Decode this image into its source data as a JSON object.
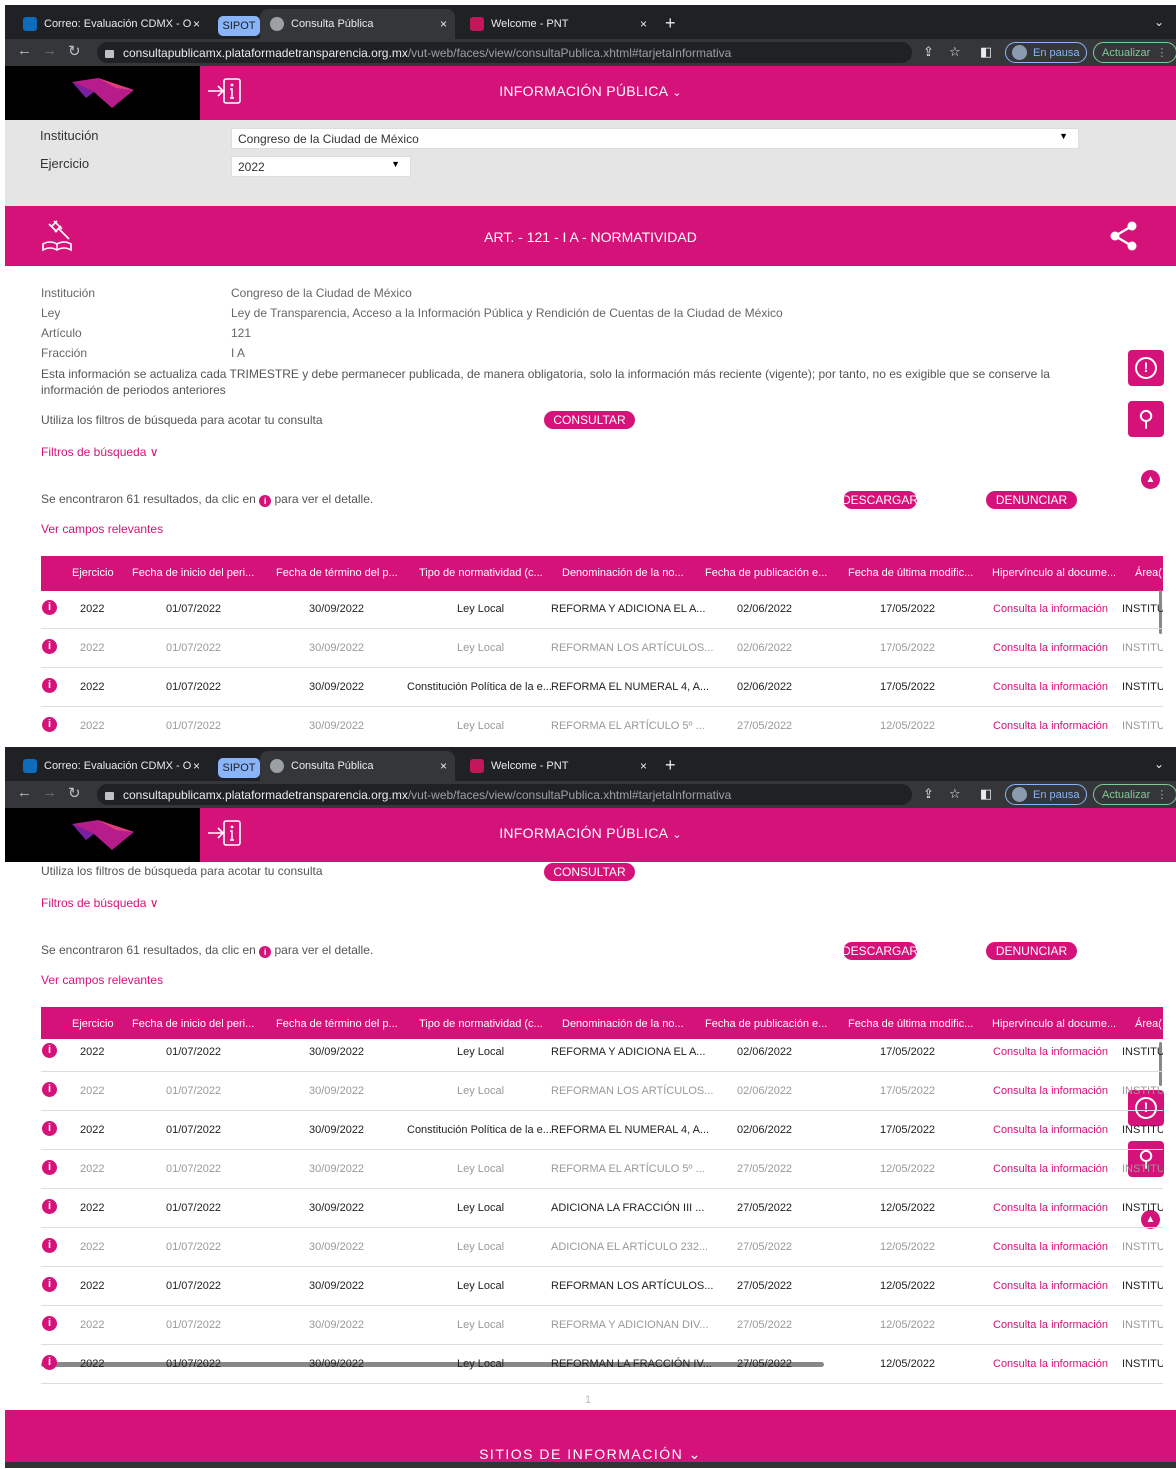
{
  "browser": {
    "tabs": [
      {
        "title": "Correo: Evaluación CDMX - O",
        "icon": "outlook-icon"
      },
      {
        "title": "Consulta Pública",
        "icon": "globe-icon"
      },
      {
        "title": "Welcome - PNT",
        "icon": "pnt-icon"
      }
    ],
    "tab_group_label": "SIPOT",
    "new_tab": "+",
    "close": "×",
    "url_host": "consultapublicamx.plataformadetransparencia.org.mx",
    "url_path": "/vut-web/faces/view/consultaPublica.xhtml#tarjetaInformativa",
    "paused_label": "En pausa",
    "update_label": "Actualizar"
  },
  "header": {
    "title": "INFORMACIÓN PÚBLICA",
    "chevron": "⌄",
    "exit_icon": "→ⅰ"
  },
  "filters": {
    "institution_label": "Institución",
    "institution_value": "Congreso de la Ciudad de México",
    "year_label": "Ejercicio",
    "year_value": "2022"
  },
  "article": {
    "title": "ART. - 121 - I A - NORMATIVIDAD"
  },
  "info": {
    "rows": [
      {
        "label": "Institución",
        "value": "Congreso de la Ciudad de México"
      },
      {
        "label": "Ley",
        "value": "Ley de Transparencia, Acceso a la Información Pública y Rendición de Cuentas de la Ciudad de México"
      },
      {
        "label": "Artículo",
        "value": "121"
      },
      {
        "label": "Fracción",
        "value": "I A"
      }
    ],
    "note": "Esta información se actualiza cada TRIMESTRE y debe permanecer publicada, de manera obligatoria, solo la información más reciente (vigente); por tanto, no es exigible que se conserve la información de periodos anteriores"
  },
  "search": {
    "hint": "Utiliza los filtros de búsqueda para acotar tu consulta",
    "consult_label": "CONSULTAR",
    "filters_label": "Filtros de búsqueda",
    "results_before": "Se encontraron 61 resultados, da clic en",
    "results_after": "para ver el detalle.",
    "info_glyph": "i",
    "download_label": "DESCARGAR",
    "report_label": "DENUNCIAR",
    "relevant_fields_label": "Ver campos relevantes"
  },
  "table": {
    "headers": [
      "Ejercicio",
      "Fecha de inicio del peri...",
      "Fecha de término del p...",
      "Tipo de normatividad (c...",
      "Denominación de la no...",
      "Fecha de publicación e...",
      "Fecha de última modific...",
      "Hipervínculo al docume...",
      "Área("
    ],
    "rows": [
      [
        "2022",
        "01/07/2022",
        "30/09/2022",
        "Ley Local",
        "REFORMA Y ADICIONA EL A...",
        "02/06/2022",
        "17/05/2022",
        "Consulta la información",
        "INSTITU"
      ],
      [
        "2022",
        "01/07/2022",
        "30/09/2022",
        "Ley Local",
        "REFORMAN LOS ARTÍCULOS...",
        "02/06/2022",
        "17/05/2022",
        "Consulta la información",
        "INSTITU"
      ],
      [
        "2022",
        "01/07/2022",
        "30/09/2022",
        "Constitución Política de la e...",
        "REFORMA EL NUMERAL 4, A...",
        "02/06/2022",
        "17/05/2022",
        "Consulta la información",
        "INSTITU"
      ],
      [
        "2022",
        "01/07/2022",
        "30/09/2022",
        "Ley Local",
        "REFORMA EL ARTÍCULO 5º ...",
        "27/05/2022",
        "12/05/2022",
        "Consulta la información",
        "INSTITU"
      ],
      [
        "2022",
        "01/07/2022",
        "30/09/2022",
        "Ley Local",
        "ADICIONA LA FRACCIÓN III ...",
        "27/05/2022",
        "12/05/2022",
        "Consulta la información",
        "INSTITU"
      ],
      [
        "2022",
        "01/07/2022",
        "30/09/2022",
        "Ley Local",
        "ADICIONA EL ARTÍCULO 232...",
        "27/05/2022",
        "12/05/2022",
        "Consulta la información",
        "INSTITU"
      ],
      [
        "2022",
        "01/07/2022",
        "30/09/2022",
        "Ley Local",
        "REFORMAN LOS ARTÍCULOS...",
        "27/05/2022",
        "12/05/2022",
        "Consulta la información",
        "INSTITU"
      ],
      [
        "2022",
        "01/07/2022",
        "30/09/2022",
        "Ley Local",
        "REFORMA Y ADICIONAN DIV...",
        "27/05/2022",
        "12/05/2022",
        "Consulta la información",
        "INSTITU"
      ],
      [
        "2022",
        "01/07/2022",
        "30/09/2022",
        "Ley Local",
        "REFORMAN LA FRACCIÓN IV...",
        "27/05/2022",
        "12/05/2022",
        "Consulta la información",
        "INSTITU"
      ]
    ]
  },
  "pagination": {
    "current": "1"
  },
  "footer": {
    "label": "SITIOS DE INFORMACIÓN",
    "chevron": "⌄"
  },
  "side_buttons": {
    "alert_glyph": "!",
    "tools_glyph": "⚲",
    "up_glyph": "▲"
  },
  "colors": {
    "brand": "#d5127a",
    "chrome_dark": "#202124",
    "filter_bg": "#e5e5e5"
  }
}
